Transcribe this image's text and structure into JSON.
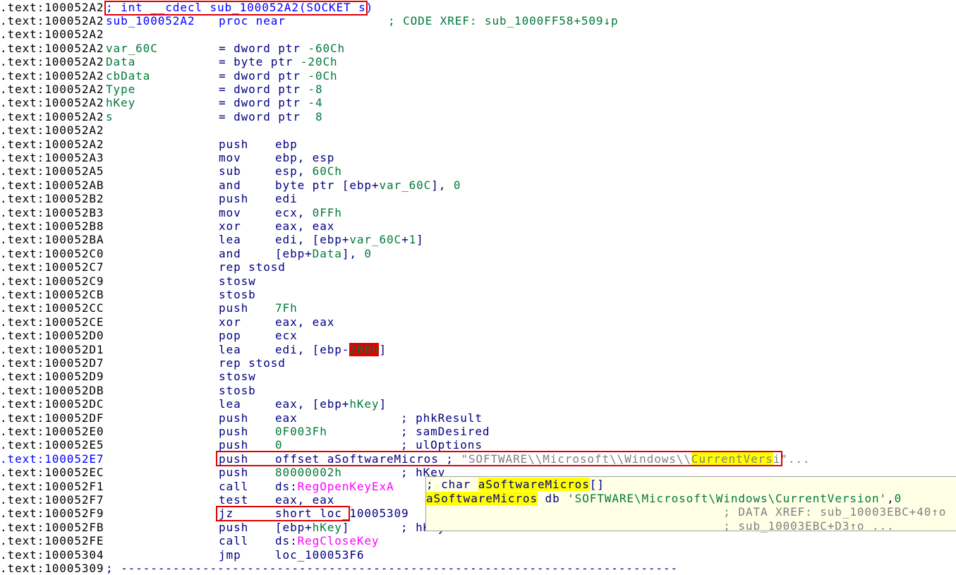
{
  "lines": [
    {
      "addr": ".text:100052A2",
      "lbl": [
        [
          "; int __cdecl sub_100052A2(SOCKET s)",
          "b"
        ]
      ]
    },
    {
      "addr": ".text:100052A2",
      "lbl": [
        [
          "sub_100052A2",
          "b"
        ]
      ],
      "mn": [
        [
          "proc near",
          "b"
        ]
      ],
      "cmx": [
        [
          "; CODE XREF: sub_1000FF58+509↓p",
          "gc"
        ]
      ]
    },
    {
      "addr": ".text:100052A2"
    },
    {
      "addr": ".text:100052A2",
      "lbl": [
        [
          "var_60C",
          "g"
        ]
      ],
      "mn": [
        [
          "= dword ptr ",
          "k"
        ],
        [
          "-60Ch",
          "g"
        ]
      ]
    },
    {
      "addr": ".text:100052A2",
      "lbl": [
        [
          "Data",
          "g"
        ]
      ],
      "mn": [
        [
          "= byte ptr ",
          "k"
        ],
        [
          "-20Ch",
          "g"
        ]
      ]
    },
    {
      "addr": ".text:100052A2",
      "lbl": [
        [
          "cbData",
          "g"
        ]
      ],
      "mn": [
        [
          "= dword ptr ",
          "k"
        ],
        [
          "-0Ch",
          "g"
        ]
      ]
    },
    {
      "addr": ".text:100052A2",
      "lbl": [
        [
          "Type",
          "g"
        ]
      ],
      "mn": [
        [
          "= dword ptr ",
          "k"
        ],
        [
          "-8",
          "g"
        ]
      ]
    },
    {
      "addr": ".text:100052A2",
      "lbl": [
        [
          "hKey",
          "g"
        ]
      ],
      "mn": [
        [
          "= dword ptr ",
          "k"
        ],
        [
          "-4",
          "g"
        ]
      ]
    },
    {
      "addr": ".text:100052A2",
      "lbl": [
        [
          "s",
          "g"
        ]
      ],
      "mn": [
        [
          "= dword ptr  ",
          "k"
        ],
        [
          "8",
          "g"
        ]
      ]
    },
    {
      "addr": ".text:100052A2"
    },
    {
      "addr": ".text:100052A2",
      "mn": [
        [
          "push",
          "k"
        ]
      ],
      "op": [
        [
          "ebp",
          "k"
        ]
      ]
    },
    {
      "addr": ".text:100052A3",
      "mn": [
        [
          "mov",
          "k"
        ]
      ],
      "op": [
        [
          "ebp, esp",
          "k"
        ]
      ]
    },
    {
      "addr": ".text:100052A5",
      "mn": [
        [
          "sub",
          "k"
        ]
      ],
      "op": [
        [
          "esp, ",
          "k"
        ],
        [
          "60Ch",
          "g"
        ]
      ]
    },
    {
      "addr": ".text:100052AB",
      "mn": [
        [
          "and",
          "k"
        ]
      ],
      "op": [
        [
          "byte ptr [ebp+",
          "k"
        ],
        [
          "var_60C",
          "g"
        ],
        [
          "], ",
          "k"
        ],
        [
          "0",
          "g"
        ]
      ]
    },
    {
      "addr": ".text:100052B2",
      "mn": [
        [
          "push",
          "k"
        ]
      ],
      "op": [
        [
          "edi",
          "k"
        ]
      ]
    },
    {
      "addr": ".text:100052B3",
      "mn": [
        [
          "mov",
          "k"
        ]
      ],
      "op": [
        [
          "ecx, ",
          "k"
        ],
        [
          "0FFh",
          "g"
        ]
      ]
    },
    {
      "addr": ".text:100052B8",
      "mn": [
        [
          "xor",
          "k"
        ]
      ],
      "op": [
        [
          "eax, eax",
          "k"
        ]
      ]
    },
    {
      "addr": ".text:100052BA",
      "mn": [
        [
          "lea",
          "k"
        ]
      ],
      "op": [
        [
          "edi, [ebp+",
          "k"
        ],
        [
          "var_60C",
          "g"
        ],
        [
          "+",
          "k"
        ],
        [
          "1",
          "g"
        ],
        [
          "]",
          "k"
        ]
      ]
    },
    {
      "addr": ".text:100052C0",
      "mn": [
        [
          "and",
          "k"
        ]
      ],
      "op": [
        [
          "[ebp+",
          "k"
        ],
        [
          "Data",
          "g"
        ],
        [
          "], ",
          "k"
        ],
        [
          "0",
          "g"
        ]
      ]
    },
    {
      "addr": ".text:100052C7",
      "mn": [
        [
          "rep stosd",
          "k"
        ]
      ]
    },
    {
      "addr": ".text:100052C9",
      "mn": [
        [
          "stosw",
          "k"
        ]
      ]
    },
    {
      "addr": ".text:100052CB",
      "mn": [
        [
          "stosb",
          "k"
        ]
      ]
    },
    {
      "addr": ".text:100052CC",
      "mn": [
        [
          "push",
          "k"
        ]
      ],
      "op": [
        [
          "7Fh",
          "g"
        ]
      ]
    },
    {
      "addr": ".text:100052CE",
      "mn": [
        [
          "xor",
          "k"
        ]
      ],
      "op": [
        [
          "eax, eax",
          "k"
        ]
      ]
    },
    {
      "addr": ".text:100052D0",
      "mn": [
        [
          "pop",
          "k"
        ]
      ],
      "op": [
        [
          "ecx",
          "k"
        ]
      ]
    },
    {
      "addr": ".text:100052D1",
      "mn": [
        [
          "lea",
          "k"
        ]
      ],
      "op": [
        [
          "edi, [ebp-",
          "k"
        ],
        [
          "20Bh",
          "g rd"
        ],
        [
          "]",
          "k"
        ]
      ]
    },
    {
      "addr": ".text:100052D7",
      "mn": [
        [
          "rep stosd",
          "k"
        ]
      ]
    },
    {
      "addr": ".text:100052D9",
      "mn": [
        [
          "stosw",
          "k"
        ]
      ]
    },
    {
      "addr": ".text:100052DB",
      "mn": [
        [
          "stosb",
          "k"
        ]
      ]
    },
    {
      "addr": ".text:100052DC",
      "mn": [
        [
          "lea",
          "k"
        ]
      ],
      "op": [
        [
          "eax, [ebp+",
          "k"
        ],
        [
          "hKey",
          "g"
        ],
        [
          "]",
          "k"
        ]
      ]
    },
    {
      "addr": ".text:100052DF",
      "mn": [
        [
          "push",
          "k"
        ]
      ],
      "op": [
        [
          "eax",
          "k"
        ]
      ],
      "cm": [
        [
          "; phkResult",
          "k"
        ]
      ]
    },
    {
      "addr": ".text:100052E0",
      "mn": [
        [
          "push",
          "k"
        ]
      ],
      "op": [
        [
          "0F003Fh",
          "g"
        ]
      ],
      "cm": [
        [
          "; samDesired",
          "k"
        ]
      ]
    },
    {
      "addr": ".text:100052E5",
      "mn": [
        [
          "push",
          "k"
        ]
      ],
      "op": [
        [
          "0",
          "g"
        ]
      ],
      "cm": [
        [
          "; ulOptions",
          "k"
        ]
      ]
    },
    {
      "addr": ".text:100052E7",
      "current": true,
      "mn": [
        [
          "push",
          "k"
        ]
      ],
      "op": [
        [
          "offset aSoftwareMicros",
          "k"
        ]
      ],
      "cmi": [
        [
          " ; ",
          "k"
        ],
        [
          "\"SOFTWARE\\\\Microsoft\\\\Windows\\\\",
          "gr"
        ],
        [
          "CurrentVers",
          "gr hl"
        ],
        [
          "i",
          "gr"
        ],
        [
          "\"...",
          "gr"
        ]
      ]
    },
    {
      "addr": ".text:100052EC",
      "mn": [
        [
          "push",
          "k"
        ]
      ],
      "op": [
        [
          "80000002h",
          "g"
        ]
      ],
      "cm": [
        [
          "; hKey",
          "k"
        ]
      ]
    },
    {
      "addr": ".text:100052F1",
      "mn": [
        [
          "call",
          "k"
        ]
      ],
      "op": [
        [
          "ds:",
          "k"
        ],
        [
          "RegOpenKeyExA",
          "m"
        ]
      ]
    },
    {
      "addr": ".text:100052F7",
      "mn": [
        [
          "test",
          "k"
        ]
      ],
      "op": [
        [
          "eax, eax",
          "k"
        ]
      ]
    },
    {
      "addr": ".text:100052F9",
      "mn": [
        [
          "jz",
          "k"
        ]
      ],
      "op": [
        [
          "short loc_10005309",
          "k"
        ]
      ]
    },
    {
      "addr": ".text:100052FB",
      "mn": [
        [
          "push",
          "k"
        ]
      ],
      "op": [
        [
          "[ebp+",
          "k"
        ],
        [
          "hKey",
          "g"
        ],
        [
          "]",
          "k"
        ]
      ],
      "cm": [
        [
          "; hKey",
          "k"
        ]
      ]
    },
    {
      "addr": ".text:100052FE",
      "mn": [
        [
          "call",
          "k"
        ]
      ],
      "op": [
        [
          "ds:",
          "k"
        ],
        [
          "RegCloseKey",
          "m"
        ]
      ]
    },
    {
      "addr": ".text:10005304",
      "mn": [
        [
          "jmp",
          "k"
        ]
      ],
      "op": [
        [
          "loc_100053F6",
          "k"
        ]
      ]
    },
    {
      "addr": ".text:10005309",
      "lbl": [
        [
          "; ---------------------------------------------------------------------------",
          "k"
        ]
      ]
    }
  ],
  "tooltip": [
    [
      [
        "; char ",
        "k"
      ],
      [
        "aSoftwareMicros",
        "k hl"
      ],
      [
        "[]",
        "k"
      ]
    ],
    [
      [
        "aSoftwareMicros",
        "k hl"
      ],
      [
        " db ",
        "k"
      ],
      [
        "'SOFTWARE\\Microsoft\\Windows\\CurrentVersion'",
        "g"
      ],
      [
        ",",
        "k"
      ],
      [
        "0",
        "g"
      ]
    ],
    [
      [
        "                                        ; DATA XREF: sub_10003EBC+40↑o",
        "gr"
      ]
    ],
    [
      [
        "                                        ; sub_10003EBC+D3↑o ...",
        "gr"
      ]
    ]
  ],
  "colors": {
    "highlight_box": "#e00000",
    "search_highlight": "#ffff00",
    "tooltip_bg": "#ffffe6"
  }
}
